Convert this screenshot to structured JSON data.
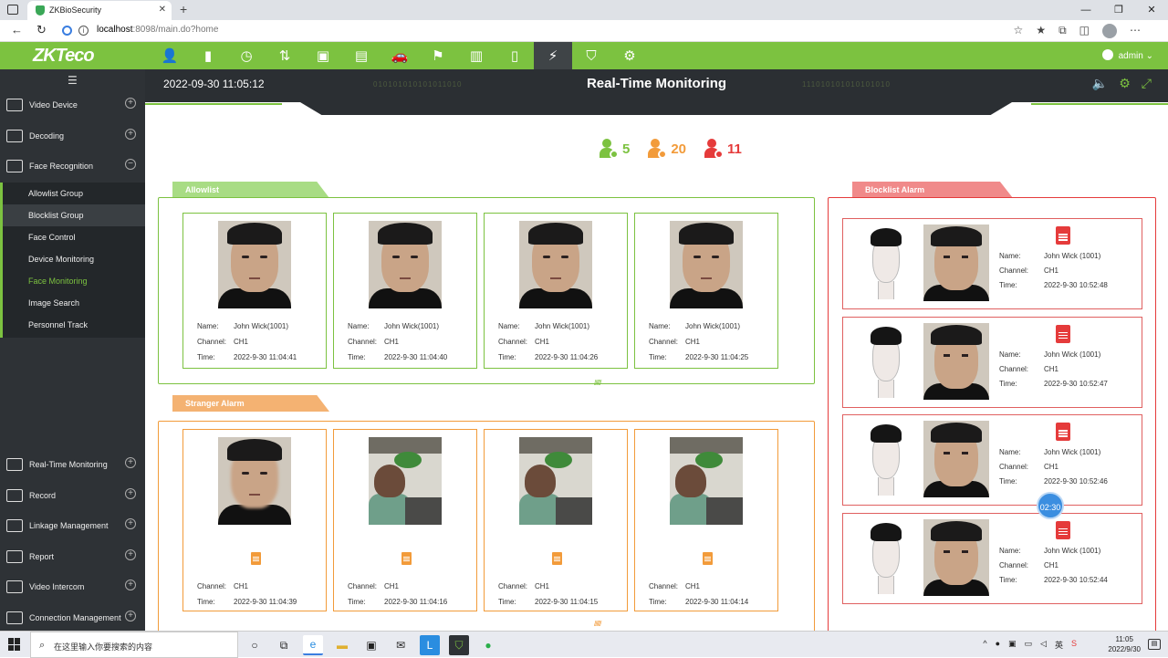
{
  "browser": {
    "tab_title": "ZKBioSecurity",
    "url_host": "localhost",
    "url_rest": ":8098/main.do?home"
  },
  "app": {
    "logo": "ZKTeco",
    "user": "admin",
    "modules": [
      "personnel-icon",
      "door-icon",
      "clock-icon",
      "elevator-icon",
      "visitor-icon",
      "parking-icon",
      "car-icon",
      "patrol-icon",
      "building-icon",
      "locker-icon",
      "video-icon",
      "shield-icon",
      "gear-icon"
    ],
    "active_module": "video-icon"
  },
  "sidebar": {
    "sections_top": [
      {
        "label": "Video Device",
        "icon": "camera-icon",
        "toggle": "+"
      },
      {
        "label": "Decoding",
        "icon": "decoder-icon",
        "toggle": "+"
      },
      {
        "label": "Face Recognition",
        "icon": "face-icon",
        "toggle": "−"
      }
    ],
    "sub_items": [
      {
        "label": "Allowlist Group"
      },
      {
        "label": "Blocklist Group"
      },
      {
        "label": "Face Control"
      },
      {
        "label": "Device Monitoring"
      },
      {
        "label": "Face Monitoring"
      },
      {
        "label": "Image Search"
      },
      {
        "label": "Personnel Track"
      }
    ],
    "active_sub": "Face Monitoring",
    "hover_sub": "Blocklist Group",
    "sections_bottom": [
      {
        "label": "Real-Time Monitoring",
        "icon": "monitor-icon",
        "toggle": "+"
      },
      {
        "label": "Record",
        "icon": "record-icon",
        "toggle": "+"
      },
      {
        "label": "Linkage Management",
        "icon": "linkage-icon",
        "toggle": "+"
      },
      {
        "label": "Report",
        "icon": "report-icon",
        "toggle": "+"
      },
      {
        "label": "Video Intercom",
        "icon": "intercom-icon",
        "toggle": "+"
      },
      {
        "label": "Connection Management",
        "icon": "link-icon",
        "toggle": "+"
      }
    ]
  },
  "main": {
    "datetime": "2022-09-30 11:05:12",
    "title": "Real-Time Monitoring",
    "counters": {
      "allow": "5",
      "stranger": "20",
      "block": "11"
    },
    "colors": {
      "green": "#7cc240",
      "orange": "#f29b3a",
      "red": "#e53b3b"
    },
    "labels": {
      "name": "Name:",
      "channel": "Channel:",
      "time": "Time:"
    },
    "allowlist": {
      "title": "Allowlist",
      "cards": [
        {
          "name": "John Wick(1001)",
          "channel": "CH1",
          "time": "2022-9-30 11:04:41"
        },
        {
          "name": "John Wick(1001)",
          "channel": "CH1",
          "time": "2022-9-30 11:04:40"
        },
        {
          "name": "John Wick(1001)",
          "channel": "CH1",
          "time": "2022-9-30 11:04:26"
        },
        {
          "name": "John Wick(1001)",
          "channel": "CH1",
          "time": "2022-9-30 11:04:25"
        }
      ]
    },
    "stranger": {
      "title": "Stranger Alarm",
      "cards": [
        {
          "channel": "CH1",
          "time": "2022-9-30 11:04:39"
        },
        {
          "channel": "CH1",
          "time": "2022-9-30 11:04:16"
        },
        {
          "channel": "CH1",
          "time": "2022-9-30 11:04:15"
        },
        {
          "channel": "CH1",
          "time": "2022-9-30 11:04:14"
        }
      ]
    },
    "blocklist": {
      "title": "Blocklist Alarm",
      "cards": [
        {
          "name": "John Wick (1001)",
          "channel": "CH1",
          "time": "2022-9-30 10:52:48"
        },
        {
          "name": "John Wick (1001)",
          "channel": "CH1",
          "time": "2022-9-30 10:52:47"
        },
        {
          "name": "John Wick (1001)",
          "channel": "CH1",
          "time": "2022-9-30 10:52:46"
        },
        {
          "name": "John Wick (1001)",
          "channel": "CH1",
          "time": "2022-9-30 10:52:44"
        }
      ]
    },
    "timer": "02:30"
  },
  "taskbar": {
    "search_placeholder": "在这里输入你要搜索的内容",
    "time": "11:05",
    "date": "2022/9/30",
    "ime": "英"
  }
}
